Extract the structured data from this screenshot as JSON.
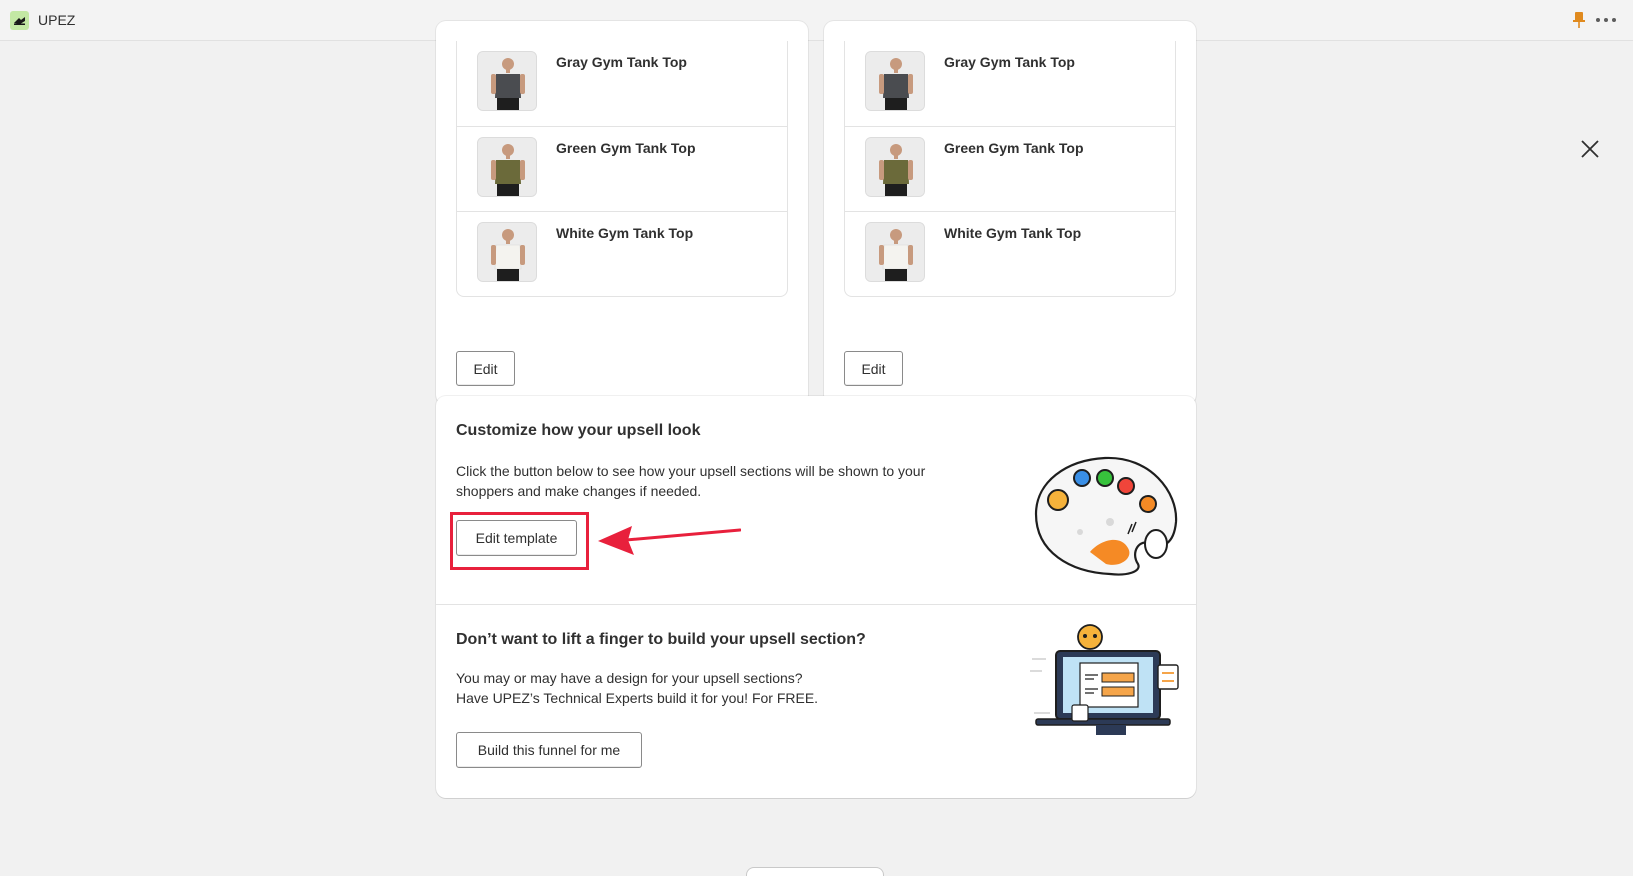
{
  "app": {
    "name": "UPEZ"
  },
  "columns": [
    {
      "products": [
        {
          "name": "Gray Gym Tank Top",
          "shirt_color": "#4a4c50"
        },
        {
          "name": "Green Gym Tank Top",
          "shirt_color": "#6b6a3a"
        },
        {
          "name": "White Gym Tank Top",
          "shirt_color": "#f4f3ef"
        }
      ],
      "edit_label": "Edit"
    },
    {
      "products": [
        {
          "name": "Gray Gym Tank Top",
          "shirt_color": "#4a4c50"
        },
        {
          "name": "Green Gym Tank Top",
          "shirt_color": "#6b6a3a"
        },
        {
          "name": "White Gym Tank Top",
          "shirt_color": "#f4f3ef"
        }
      ],
      "edit_label": "Edit"
    }
  ],
  "customize": {
    "title": "Customize how your upsell look",
    "description_line1": "Click the button below to see how your upsell sections will be shown to your",
    "description_line2": "shoppers and make changes if needed.",
    "button_label": "Edit template"
  },
  "build": {
    "title": "Don’t want to lift a finger to build your upsell section?",
    "line1": "You may or may have a design for your upsell sections?",
    "line2": "Have UPEZ’s Technical Experts build it for you! For FREE.",
    "button_label": "Build this funnel for me"
  },
  "colors": {
    "highlight": "#e8203c",
    "pin": "#e08a1e"
  },
  "icons": [
    "app-logo-icon",
    "pin-icon",
    "more-icon",
    "close-icon",
    "arrow-icon",
    "palette-illustration-icon",
    "computer-illustration-icon"
  ]
}
